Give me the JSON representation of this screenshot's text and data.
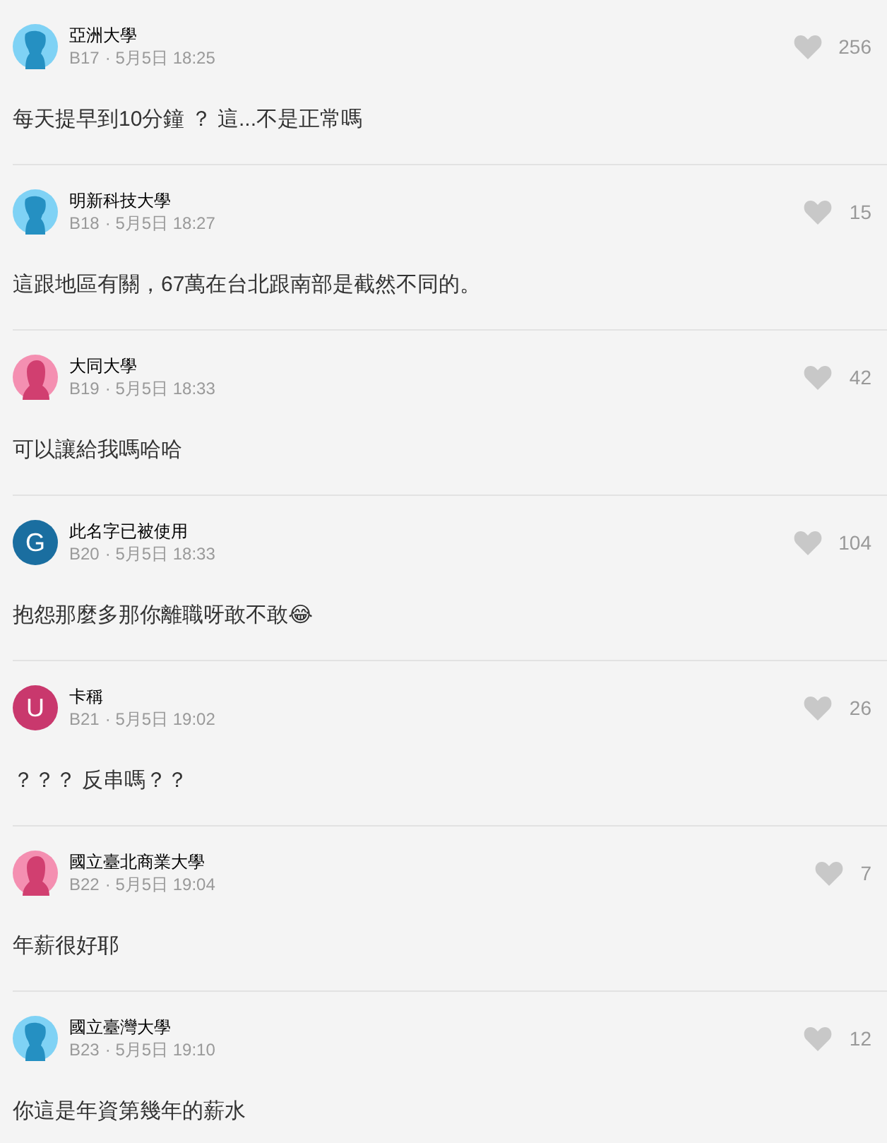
{
  "comments": [
    {
      "author": "亞洲大學",
      "avatar": {
        "kind": "male"
      },
      "floor": "B17",
      "time": "· 5月5日 18:25",
      "likes": "256",
      "content": "每天提早到10分鐘 ？ 這...不是正常嗎"
    },
    {
      "author": "明新科技大學",
      "avatar": {
        "kind": "male"
      },
      "floor": "B18",
      "time": "· 5月5日 18:27",
      "likes": "15",
      "content": "這跟地區有關，67萬在台北跟南部是截然不同的。"
    },
    {
      "author": "大同大學",
      "avatar": {
        "kind": "female"
      },
      "floor": "B19",
      "time": "· 5月5日 18:33",
      "likes": "42",
      "content": "可以讓給我嗎哈哈"
    },
    {
      "author": "此名字已被使用",
      "avatar": {
        "kind": "letter",
        "letter": "G",
        "color": "#1a6ea0"
      },
      "floor": "B20",
      "time": "· 5月5日 18:33",
      "likes": "104",
      "content": "抱怨那麼多那你離職呀敢不敢😂"
    },
    {
      "author": "卡稱",
      "avatar": {
        "kind": "letter",
        "letter": "U",
        "color": "#c9386d"
      },
      "floor": "B21",
      "time": "· 5月5日 19:02",
      "likes": "26",
      "content": "？？？ 反串嗎？？"
    },
    {
      "author": "國立臺北商業大學",
      "avatar": {
        "kind": "female"
      },
      "floor": "B22",
      "time": "· 5月5日 19:04",
      "likes": "7",
      "content": "年薪很好耶"
    },
    {
      "author": "國立臺灣大學",
      "avatar": {
        "kind": "male"
      },
      "floor": "B23",
      "time": "· 5月5日 19:10",
      "likes": "12",
      "content": "你這是年資第幾年的薪水"
    }
  ]
}
